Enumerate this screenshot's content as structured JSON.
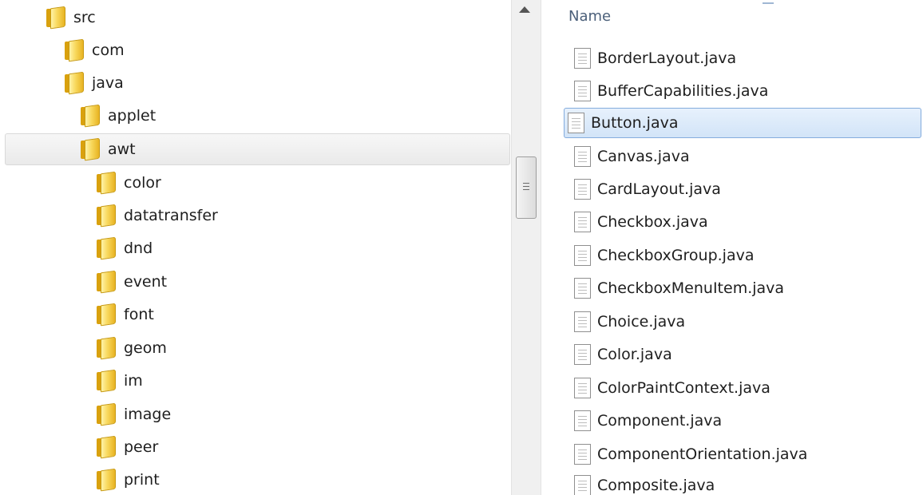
{
  "tree": {
    "items": [
      {
        "label": "src"
      },
      {
        "label": "com"
      },
      {
        "label": "java"
      },
      {
        "label": "applet"
      },
      {
        "label": "awt",
        "selected": true
      },
      {
        "label": "color"
      },
      {
        "label": "datatransfer"
      },
      {
        "label": "dnd"
      },
      {
        "label": "event"
      },
      {
        "label": "font"
      },
      {
        "label": "geom"
      },
      {
        "label": "im"
      },
      {
        "label": "image"
      },
      {
        "label": "peer"
      },
      {
        "label": "print"
      }
    ]
  },
  "file_list": {
    "column_header": "Name",
    "files": [
      {
        "name": "BorderLayout.java"
      },
      {
        "name": "BufferCapabilities.java"
      },
      {
        "name": "Button.java",
        "selected": true
      },
      {
        "name": "Canvas.java"
      },
      {
        "name": "CardLayout.java"
      },
      {
        "name": "Checkbox.java"
      },
      {
        "name": "CheckboxGroup.java"
      },
      {
        "name": "CheckboxMenuItem.java"
      },
      {
        "name": "Choice.java"
      },
      {
        "name": "Color.java"
      },
      {
        "name": "ColorPaintContext.java"
      },
      {
        "name": "Component.java"
      },
      {
        "name": "ComponentOrientation.java"
      },
      {
        "name": "Composite.java"
      }
    ]
  },
  "icons": {
    "folder": "folder-icon",
    "file": "java-file-icon",
    "scroll_up": "scroll-up-arrow-icon"
  },
  "colors": {
    "selection_blue": "#d2e4f8",
    "selection_border": "#84acdd",
    "folder_yellow": "#f8d85c"
  }
}
